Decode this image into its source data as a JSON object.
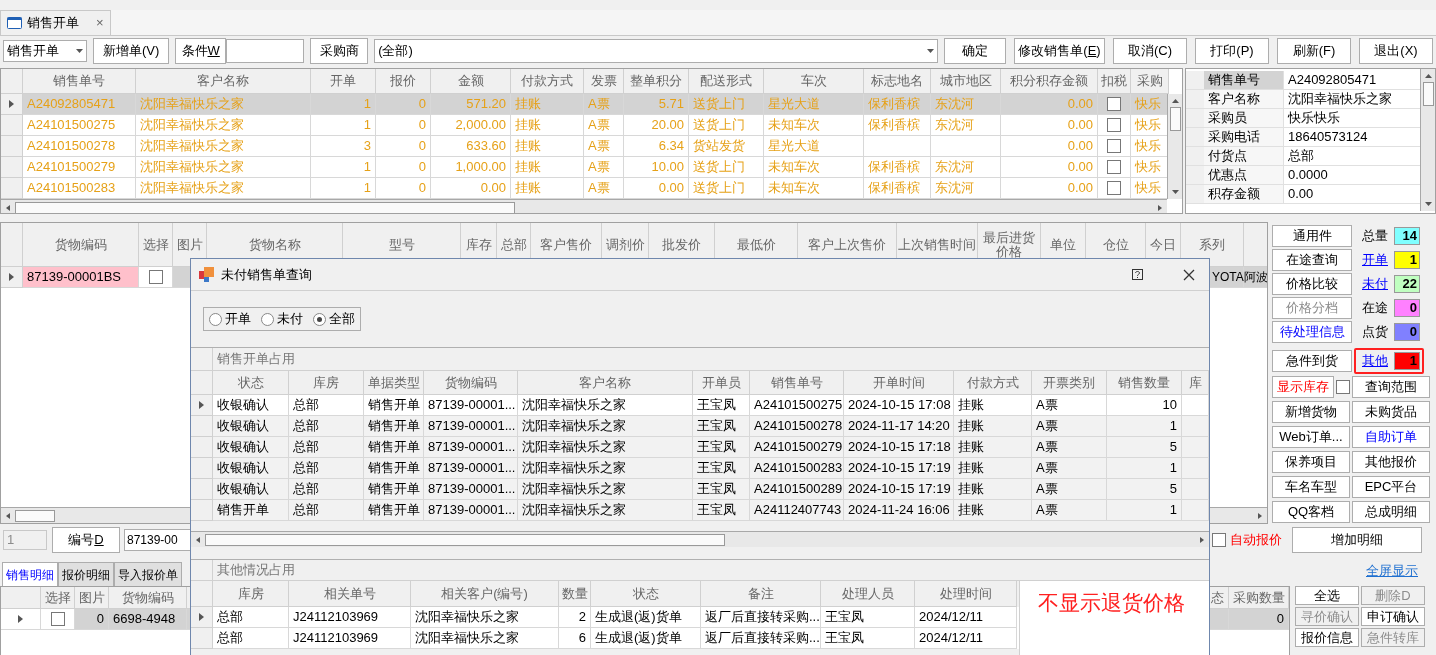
{
  "tab_strip": {
    "tabs": [
      {
        "label": "销售开单",
        "selected": true,
        "close": "×"
      }
    ]
  },
  "toolbar": {
    "doc_type": "销售开单",
    "new_order": "新增单(V)",
    "condition": {
      "label": "条件",
      "mnemonic": "W"
    },
    "buyer_button": "采购商",
    "buyer_value": "(全部)",
    "confirm": "确定",
    "edit": {
      "label": "修改销售单(",
      "mnemonic": "E",
      "suffix": ")"
    },
    "actions": [
      "取消(C)",
      "打印(P)",
      "刷新(F)",
      "退出(X)"
    ]
  },
  "orders": {
    "columns": [
      {
        "label": "销售单号",
        "kind": "text"
      },
      {
        "label": "客户名称",
        "kind": "text"
      },
      {
        "label": "开单",
        "kind": "num"
      },
      {
        "label": "报价",
        "kind": "num"
      },
      {
        "label": "金额",
        "kind": "num"
      },
      {
        "label": "付款方式",
        "kind": "text"
      },
      {
        "label": "发票",
        "kind": "text"
      },
      {
        "label": "整单积分",
        "kind": "num"
      },
      {
        "label": "配送形式",
        "kind": "text"
      },
      {
        "label": "车次",
        "kind": "text"
      },
      {
        "label": "标志地名",
        "kind": "text"
      },
      {
        "label": "城市地区",
        "kind": "text"
      },
      {
        "label": "积分积存金额",
        "kind": "num"
      },
      {
        "label": "扣税",
        "kind": "check"
      },
      {
        "label": "采购",
        "kind": "text"
      }
    ],
    "rows": [
      {
        "selected": true,
        "cells": [
          "A24092805471",
          "沈阳幸福快乐之家",
          "1",
          "0",
          "571.20",
          "挂账",
          "A票",
          "5.71",
          "送货上门",
          "星光大道",
          "保利香槟",
          "东沈河",
          "0.00",
          false,
          "快乐"
        ]
      },
      {
        "selected": false,
        "cells": [
          "A24101500275",
          "沈阳幸福快乐之家",
          "1",
          "0",
          "2,000.00",
          "挂账",
          "A票",
          "20.00",
          "送货上门",
          "未知车次",
          "保利香槟",
          "东沈河",
          "0.00",
          false,
          "快乐"
        ]
      },
      {
        "selected": false,
        "cells": [
          "A24101500278",
          "沈阳幸福快乐之家",
          "3",
          "0",
          "633.60",
          "挂账",
          "A票",
          "6.34",
          "货站发货",
          "星光大道",
          null,
          null,
          "0.00",
          false,
          "快乐"
        ]
      },
      {
        "selected": false,
        "cells": [
          "A24101500279",
          "沈阳幸福快乐之家",
          "1",
          "0",
          "1,000.00",
          "挂账",
          "A票",
          "10.00",
          "送货上门",
          "未知车次",
          "保利香槟",
          "东沈河",
          "0.00",
          false,
          "快乐"
        ]
      },
      {
        "selected": false,
        "cells": [
          "A24101500283",
          "沈阳幸福快乐之家",
          "1",
          "0",
          "0.00",
          "挂账",
          "A票",
          "0.00",
          "送货上门",
          "未知车次",
          "保利香槟",
          "东沈河",
          "0.00",
          false,
          "快乐"
        ]
      }
    ]
  },
  "details": [
    {
      "label": "销售单号",
      "value": "A24092805471",
      "selected": true
    },
    {
      "label": "客户名称",
      "value": "沈阳幸福快乐之家",
      "selected": false
    },
    {
      "label": "采购员",
      "value": "快乐快乐",
      "selected": false
    },
    {
      "label": "采购电话",
      "value": "18640573124",
      "selected": false
    },
    {
      "label": "付货点",
      "value": "总部",
      "selected": false
    },
    {
      "label": "优惠点",
      "value": "0.0000",
      "selected": false
    },
    {
      "label": "积存金额",
      "value": "0.00",
      "selected": false
    }
  ],
  "goods": {
    "columns": [
      "货物编码",
      "选择",
      "图片",
      "货物名称",
      "型号",
      "库存",
      "总部",
      "客户售价",
      "调剂价",
      "批发价",
      "最低价",
      "客户上次售价",
      "上次销售时间",
      "最后进货价格",
      "单位",
      "仓位",
      "今日",
      "系列"
    ],
    "rows": [
      {
        "selected": true,
        "code": "87139-00001BS",
        "checked": false,
        "series": "YOTA",
        "column_19": "阿波"
      }
    ]
  },
  "side_panel": {
    "column_buttons": [
      {
        "label": "通用件",
        "kind": "normal",
        "disabled": false
      },
      {
        "label": "在途查询",
        "kind": "normal",
        "disabled": false
      },
      {
        "label": "价格比较",
        "kind": "normal",
        "disabled": false
      },
      {
        "label": "价格分档",
        "kind": "normal",
        "disabled": true
      },
      {
        "label": "待处理信息",
        "kind": "link",
        "disabled": false
      },
      {
        "label": "急件到货",
        "kind": "normal",
        "disabled": false
      }
    ],
    "counters": [
      {
        "label": "总量",
        "link": false,
        "value": "14",
        "color": "#80ffff",
        "highlighted": false
      },
      {
        "label": "开单",
        "link": true,
        "value": "1",
        "color": "#ffff00",
        "highlighted": false
      },
      {
        "label": "未付",
        "link": true,
        "value": "22",
        "color": "#c0ffc0",
        "highlighted": false
      },
      {
        "label": "在途",
        "link": false,
        "value": "0",
        "color": "#ff80ff",
        "highlighted": false
      },
      {
        "label": "点货",
        "link": false,
        "value": "0",
        "color": "#8080ff",
        "highlighted": false
      },
      {
        "label": "其他",
        "link": true,
        "value": "1",
        "color": "#ff0000",
        "highlighted": true
      }
    ],
    "show_stock": {
      "label": "显示库存",
      "checked": false
    },
    "buttons": [
      {
        "label": "查询范围",
        "kind": "normal"
      },
      {
        "label": "新增货物",
        "kind": "normal"
      },
      {
        "label": "未购货品",
        "kind": "normal"
      },
      {
        "label": "Web订单...",
        "kind": "normal"
      },
      {
        "label": "自助订单",
        "kind": "link"
      },
      {
        "label": "保养项目",
        "kind": "normal"
      },
      {
        "label": "其他报价",
        "kind": "normal"
      },
      {
        "label": "车名车型",
        "kind": "normal"
      },
      {
        "label": "EPC平台",
        "kind": "normal"
      },
      {
        "label": "QQ客档",
        "kind": "normal"
      },
      {
        "label": "总成明细",
        "kind": "normal"
      }
    ]
  },
  "lookup_bar": {
    "row_number": "1",
    "code_button": {
      "label": "编号",
      "mnemonic": "D"
    },
    "code_value": "87139-00",
    "auto_quote": {
      "label": "自动报价",
      "checked": false
    },
    "add_detail": "增加明细"
  },
  "bottom": {
    "tabs": [
      {
        "label": "销售明细",
        "selected": true
      },
      {
        "label": "报价明细",
        "selected": false
      },
      {
        "label": "导入报价单",
        "selected": false
      }
    ],
    "fullscreen_link": "全屏显示",
    "columns": [
      "选择",
      "图片",
      "货物编码",
      "态",
      "采购数量"
    ],
    "rows": [
      {
        "selected": true,
        "checked": false,
        "picture": "0",
        "code": "6698-4948",
        "quantity": "0"
      }
    ],
    "buttons": [
      {
        "label": "全选",
        "disabled": false
      },
      {
        "label": "删除D",
        "disabled": true
      },
      {
        "label": "寻价确认",
        "disabled": true
      },
      {
        "label": "申订确认",
        "disabled": false
      },
      {
        "label": "报价信息",
        "disabled": false
      },
      {
        "label": "急件转库",
        "disabled": true
      }
    ]
  },
  "dialog": {
    "title": "未付销售单查询",
    "filter": [
      {
        "label": "开单",
        "selected": false
      },
      {
        "label": "未付",
        "selected": false
      },
      {
        "label": "全部",
        "selected": true
      }
    ],
    "sales_section": {
      "title": "销售开单占用",
      "columns": [
        {
          "label": "状态",
          "kind": "text"
        },
        {
          "label": "库房",
          "kind": "text"
        },
        {
          "label": "单据类型",
          "kind": "text"
        },
        {
          "label": "货物编码",
          "kind": "text"
        },
        {
          "label": "客户名称",
          "kind": "text"
        },
        {
          "label": "开单员",
          "kind": "text"
        },
        {
          "label": "销售单号",
          "kind": "text"
        },
        {
          "label": "开单时间",
          "kind": "text"
        },
        {
          "label": "付款方式",
          "kind": "text"
        },
        {
          "label": "开票类别",
          "kind": "text"
        },
        {
          "label": "销售数量",
          "kind": "num"
        },
        {
          "label": "库",
          "kind": "text"
        }
      ],
      "rows": [
        {
          "selected": true,
          "cells": [
            "收银确认",
            "总部",
            "销售开单",
            "87139-00001...",
            "沈阳幸福快乐之家",
            "王宝凤",
            "A24101500275",
            "2024-10-15 17:08",
            "挂账",
            "A票",
            "10"
          ]
        },
        {
          "selected": false,
          "cells": [
            "收银确认",
            "总部",
            "销售开单",
            "87139-00001...",
            "沈阳幸福快乐之家",
            "王宝凤",
            "A24101500278",
            "2024-11-17 14:20",
            "挂账",
            "A票",
            "1"
          ]
        },
        {
          "selected": false,
          "cells": [
            "收银确认",
            "总部",
            "销售开单",
            "87139-00001...",
            "沈阳幸福快乐之家",
            "王宝凤",
            "A24101500279",
            "2024-10-15 17:18",
            "挂账",
            "A票",
            "5"
          ]
        },
        {
          "selected": false,
          "cells": [
            "收银确认",
            "总部",
            "销售开单",
            "87139-00001...",
            "沈阳幸福快乐之家",
            "王宝凤",
            "A24101500283",
            "2024-10-15 17:19",
            "挂账",
            "A票",
            "1"
          ]
        },
        {
          "selected": false,
          "cells": [
            "收银确认",
            "总部",
            "销售开单",
            "87139-00001...",
            "沈阳幸福快乐之家",
            "王宝凤",
            "A24101500289",
            "2024-10-15 17:19",
            "挂账",
            "A票",
            "5"
          ]
        },
        {
          "selected": false,
          "cells": [
            "销售开单",
            "总部",
            "销售开单",
            "87139-00001...",
            "沈阳幸福快乐之家",
            "王宝凤",
            "A24112407743",
            "2024-11-24 16:06",
            "挂账",
            "A票",
            "1"
          ]
        }
      ]
    },
    "other_section": {
      "title": "其他情况占用",
      "columns": [
        {
          "label": "库房",
          "kind": "text"
        },
        {
          "label": "相关单号",
          "kind": "text"
        },
        {
          "label": "相关客户(编号)",
          "kind": "text"
        },
        {
          "label": "数量",
          "kind": "num"
        },
        {
          "label": "状态",
          "kind": "text"
        },
        {
          "label": "备注",
          "kind": "text"
        },
        {
          "label": "处理人员",
          "kind": "text"
        },
        {
          "label": "处理时间",
          "kind": "text"
        }
      ],
      "rows": [
        {
          "selected": true,
          "cells": [
            "总部",
            "J24112103969",
            "沈阳幸福快乐之家",
            "2",
            "生成退(返)货单",
            "返厂后直接转采购...",
            "王宝凤",
            "2024/12/11"
          ]
        },
        {
          "selected": false,
          "cells": [
            "总部",
            "J24112103969",
            "沈阳幸福快乐之家",
            "6",
            "生成退(返)货单",
            "返厂后直接转采购...",
            "王宝凤",
            "2024/12/11"
          ]
        }
      ]
    },
    "notice": "不显示退货价格"
  }
}
